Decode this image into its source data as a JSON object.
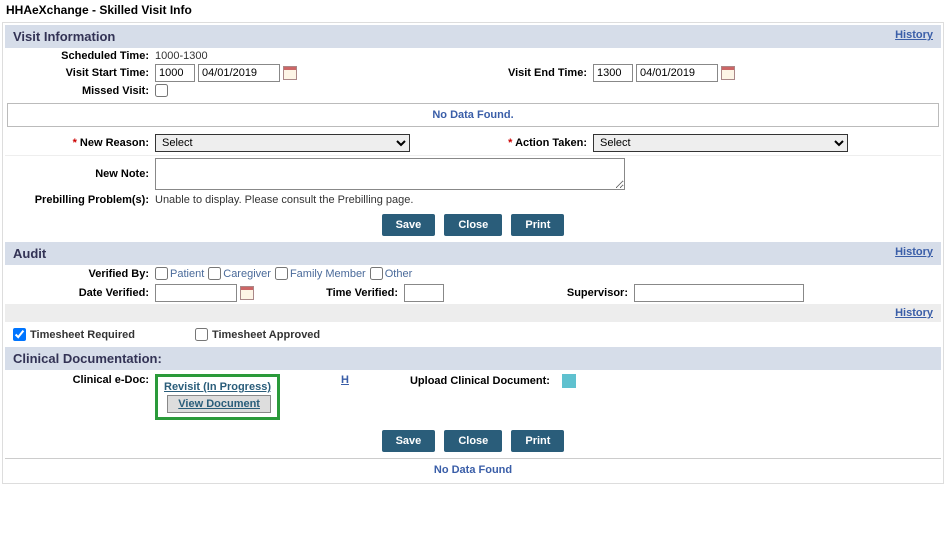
{
  "page_title": "HHAeXchange - Skilled Visit Info",
  "history_link": "History",
  "visit_info": {
    "header": "Visit Information",
    "scheduled_time_label": "Scheduled Time:",
    "scheduled_time_value": "1000-1300",
    "start_label": "Visit Start Time:",
    "start_time": "1000",
    "start_date": "04/01/2019",
    "end_label": "Visit End Time:",
    "end_time": "1300",
    "end_date": "04/01/2019",
    "missed_label": "Missed Visit:",
    "no_data": "No Data Found.",
    "new_reason_label": "New Reason:",
    "new_reason_select": "Select",
    "action_taken_label": "Action Taken:",
    "action_taken_select": "Select",
    "new_note_label": "New Note:",
    "prebilling_label": "Prebilling Problem(s):",
    "prebilling_text": "Unable to display. Please consult the Prebilling page."
  },
  "buttons": {
    "save": "Save",
    "close": "Close",
    "print": "Print"
  },
  "audit": {
    "header": "Audit",
    "verified_by_label": "Verified By:",
    "opt_patient": "Patient",
    "opt_caregiver": "Caregiver",
    "opt_family": "Family Member",
    "opt_other": "Other",
    "date_verified_label": "Date Verified:",
    "time_verified_label": "Time Verified:",
    "supervisor_label": "Supervisor:"
  },
  "timesheet": {
    "required_label": "Timesheet Required",
    "approved_label": "Timesheet Approved"
  },
  "clinical": {
    "header": "Clinical Documentation:",
    "edoc_label": "Clinical e-Doc:",
    "revisit_text": "Revisit (In Progress)",
    "view_doc": "View Document",
    "h_link": "H",
    "upload_label": "Upload Clinical Document:",
    "no_data": "No Data Found"
  }
}
